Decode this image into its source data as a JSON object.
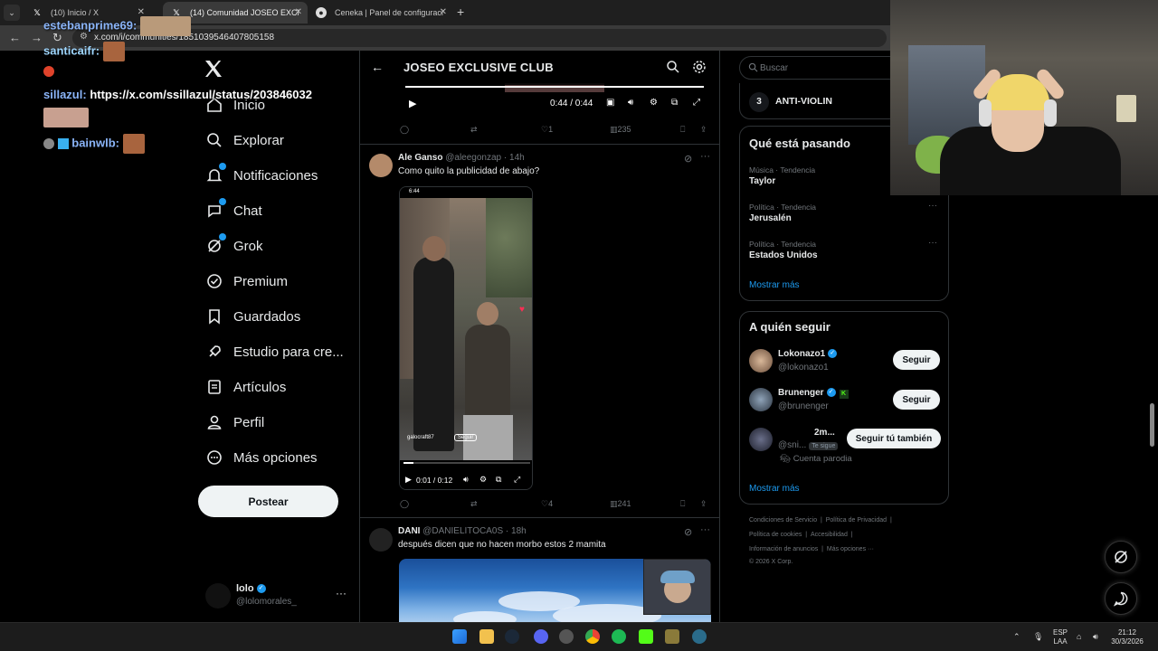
{
  "browser": {
    "tabs": [
      {
        "title": "(10) Inicio / X",
        "active": false
      },
      {
        "title": "(14) Comunidad JOSEO EXCLUS",
        "active": true
      },
      {
        "title": "Ceneka | Panel de configuración",
        "active": false
      }
    ],
    "url": "x.com/i/communities/1851039546407805158"
  },
  "chat_overlay": [
    {
      "nick": "estebanprime69:",
      "message": ""
    },
    {
      "nick": "santicaifr:",
      "message": ""
    },
    {
      "nick": "sillazul:",
      "message": "https://x.com/ssillazul/status/203846032"
    },
    {
      "nick": "bainwlb:",
      "message": ""
    }
  ],
  "sidebar": {
    "items": [
      {
        "label": "Inicio",
        "icon": "home-icon"
      },
      {
        "label": "Explorar",
        "icon": "search-icon"
      },
      {
        "label": "Notificaciones",
        "icon": "bell-icon"
      },
      {
        "label": "Chat",
        "icon": "chat-icon"
      },
      {
        "label": "Grok",
        "icon": "grok-icon"
      },
      {
        "label": "Premium",
        "icon": "premium-icon"
      },
      {
        "label": "Guardados",
        "icon": "bookmark-icon"
      },
      {
        "label": "Estudio para cre...",
        "icon": "rocket-icon"
      },
      {
        "label": "Artículos",
        "icon": "article-icon"
      },
      {
        "label": "Perfil",
        "icon": "person-icon"
      },
      {
        "label": "Más opciones",
        "icon": "more-icon"
      }
    ],
    "post_button": "Postear",
    "profile": {
      "name": "lolo",
      "handle": "@lolomorales_",
      "more": "···"
    }
  },
  "community": {
    "title": "JOSEO EXCLUSIVE CLUB"
  },
  "posts": [
    {
      "video": {
        "time": "0:44 / 0:44",
        "progress": 1.0
      },
      "actions": {
        "replies": "",
        "reposts": "",
        "likes": "1",
        "views": "235"
      }
    },
    {
      "author": "Ale Ganso",
      "handle": "@aleegonzap",
      "time": "· 14h",
      "text": "Como quito la publicidad de abajo?",
      "video": {
        "time": "0:01 / 0:12",
        "progress": 0.08
      },
      "phone": {
        "status_time": "6:44",
        "username": "galocraft87",
        "follow": "Seguir"
      },
      "actions": {
        "replies": "",
        "reposts": "",
        "likes": "4",
        "views": "241"
      }
    },
    {
      "author": "DANI",
      "handle": "@DANIELITOCA0S",
      "time": "· 18h",
      "text": "después dicen que no hacen morbo estos 2 mamita"
    }
  ],
  "right": {
    "search_placeholder": "Buscar",
    "rank": {
      "number": "3",
      "label": "ANTI-VIOLIN"
    },
    "trends_title": "Qué está pasando",
    "trends": [
      {
        "meta": "Música · Tendencia",
        "name": "Taylor"
      },
      {
        "meta": "Política · Tendencia",
        "name": "Jerusalén"
      },
      {
        "meta": "Política · Tendencia",
        "name": "Estados Unidos"
      }
    ],
    "show_more": "Mostrar más",
    "follow_title": "A quién seguir",
    "follow": [
      {
        "name": "Lokonazo1",
        "handle": "@lokonazo1",
        "button": "Seguir"
      },
      {
        "name": "Brunenger",
        "handle": "@brunenger",
        "button": "Seguir"
      },
      {
        "name": "2m...",
        "handle": "@sni...",
        "badge": "Te sigue",
        "note": "Cuenta parodia",
        "button": "Seguir tú también"
      }
    ],
    "show_more2": "Mostrar más",
    "footer": [
      "Condiciones de Servicio",
      "|",
      "Política de Privacidad",
      "|",
      "Política de cookies",
      "|",
      "Accesibilidad",
      "|",
      "Información de anuncios",
      "|",
      "Más opciones ···",
      "© 2026 X Corp."
    ]
  },
  "taskbar": {
    "lang1": "ESP",
    "lang2": "LAA",
    "time": "21:12",
    "date": "30/3/2026"
  },
  "colors": {
    "accent": "#1d9bf0",
    "background": "#000000",
    "border": "#2f3336",
    "muted": "#71767b"
  }
}
